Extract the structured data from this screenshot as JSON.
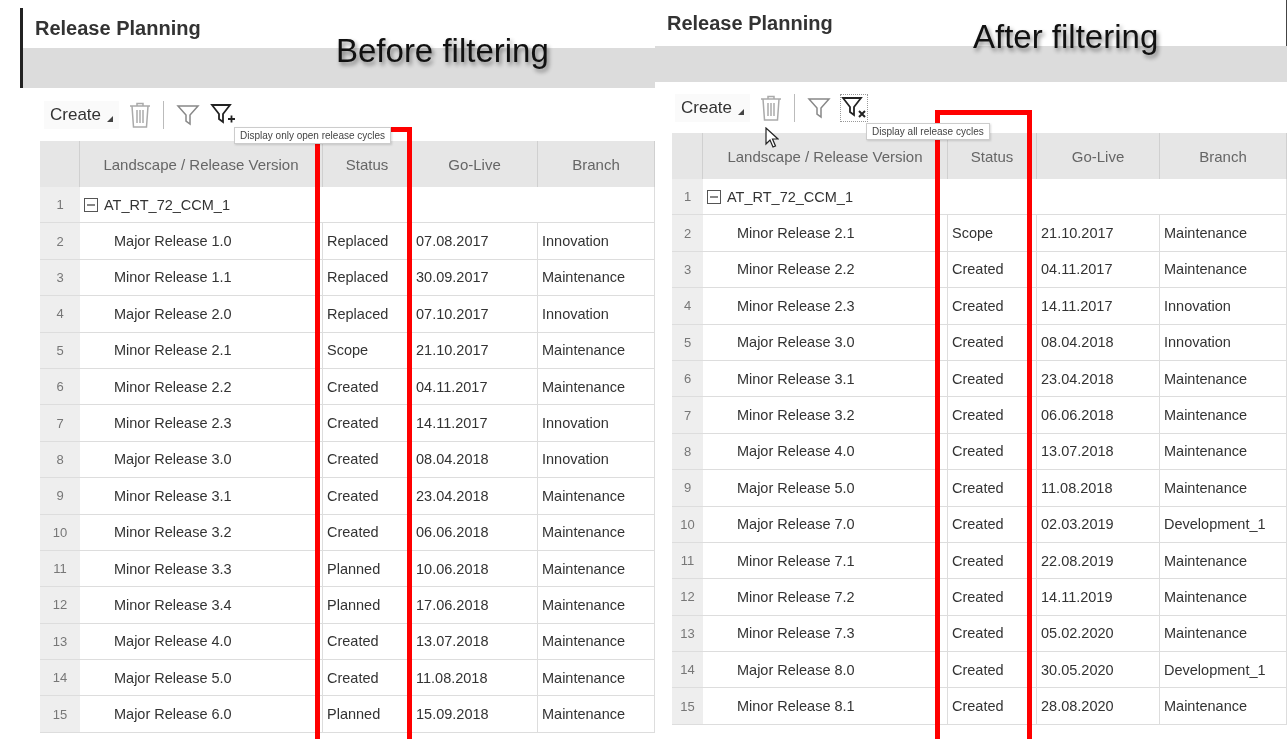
{
  "panels": [
    {
      "title": "Release Planning",
      "annotation": "Before filtering",
      "toolbar": {
        "create": "Create",
        "filter_toggle": {
          "kind": "add"
        },
        "tooltip": "Display only open release cycles",
        "pointer_cursor": false
      },
      "columns": [
        "Landscape / Release Version",
        "Status",
        "Go-Live",
        "Branch"
      ],
      "rows": [
        {
          "number": "1",
          "name": "AT_RT_72_CCM_1",
          "expanded": true,
          "children": [
            {
              "number": "2",
              "name": "Major Release 1.0",
              "status": "Replaced",
              "go_live": "07.08.2017",
              "branch": "Innovation"
            },
            {
              "number": "3",
              "name": "Minor Release 1.1",
              "status": "Replaced",
              "go_live": "30.09.2017",
              "branch": "Maintenance"
            },
            {
              "number": "4",
              "name": "Major Release 2.0",
              "status": "Replaced",
              "go_live": "07.10.2017",
              "branch": "Innovation"
            },
            {
              "number": "5",
              "name": "Minor Release 2.1",
              "status": "Scope",
              "go_live": "21.10.2017",
              "branch": "Maintenance"
            },
            {
              "number": "6",
              "name": "Minor Release 2.2",
              "status": "Created",
              "go_live": "04.11.2017",
              "branch": "Maintenance"
            },
            {
              "number": "7",
              "name": "Minor Release 2.3",
              "status": "Created",
              "go_live": "14.11.2017",
              "branch": "Innovation"
            },
            {
              "number": "8",
              "name": "Major Release 3.0",
              "status": "Created",
              "go_live": "08.04.2018",
              "branch": "Innovation"
            },
            {
              "number": "9",
              "name": "Minor Release 3.1",
              "status": "Created",
              "go_live": "23.04.2018",
              "branch": "Maintenance"
            },
            {
              "number": "10",
              "name": "Minor Release 3.2",
              "status": "Created",
              "go_live": "06.06.2018",
              "branch": "Maintenance"
            },
            {
              "number": "11",
              "name": "Minor Release 3.3",
              "status": "Planned",
              "go_live": "10.06.2018",
              "branch": "Maintenance"
            },
            {
              "number": "12",
              "name": "Minor Release 3.4",
              "status": "Planned",
              "go_live": "17.06.2018",
              "branch": "Maintenance"
            },
            {
              "number": "13",
              "name": "Major Release 4.0",
              "status": "Created",
              "go_live": "13.07.2018",
              "branch": "Maintenance"
            },
            {
              "number": "14",
              "name": "Major Release 5.0",
              "status": "Created",
              "go_live": "11.08.2018",
              "branch": "Maintenance"
            },
            {
              "number": "15",
              "name": "Major Release 6.0",
              "status": "Planned",
              "go_live": "15.09.2018",
              "branch": "Maintenance"
            }
          ]
        }
      ]
    },
    {
      "title": "Release Planning",
      "annotation": "After filtering",
      "toolbar": {
        "create": "Create",
        "filter_toggle": {
          "kind": "clear"
        },
        "tooltip": "Display all release cycles",
        "pointer_cursor": true
      },
      "columns": [
        "Landscape / Release Version",
        "Status",
        "Go-Live",
        "Branch"
      ],
      "rows": [
        {
          "number": "1",
          "name": "AT_RT_72_CCM_1",
          "expanded": true,
          "children": [
            {
              "number": "2",
              "name": "Minor Release 2.1",
              "status": "Scope",
              "go_live": "21.10.2017",
              "branch": "Maintenance"
            },
            {
              "number": "3",
              "name": "Minor Release 2.2",
              "status": "Created",
              "go_live": "04.11.2017",
              "branch": "Maintenance"
            },
            {
              "number": "4",
              "name": "Minor Release 2.3",
              "status": "Created",
              "go_live": "14.11.2017",
              "branch": "Innovation"
            },
            {
              "number": "5",
              "name": "Major Release 3.0",
              "status": "Created",
              "go_live": "08.04.2018",
              "branch": "Innovation"
            },
            {
              "number": "6",
              "name": "Minor Release 3.1",
              "status": "Created",
              "go_live": "23.04.2018",
              "branch": "Maintenance"
            },
            {
              "number": "7",
              "name": "Minor Release 3.2",
              "status": "Created",
              "go_live": "06.06.2018",
              "branch": "Maintenance"
            },
            {
              "number": "8",
              "name": "Major Release 4.0",
              "status": "Created",
              "go_live": "13.07.2018",
              "branch": "Maintenance"
            },
            {
              "number": "9",
              "name": "Major Release 5.0",
              "status": "Created",
              "go_live": "11.08.2018",
              "branch": "Maintenance"
            },
            {
              "number": "10",
              "name": "Major Release 7.0",
              "status": "Created",
              "go_live": "02.03.2019",
              "branch": "Development_1"
            },
            {
              "number": "11",
              "name": "Minor Release 7.1",
              "status": "Created",
              "go_live": "22.08.2019",
              "branch": "Maintenance"
            },
            {
              "number": "12",
              "name": "Minor Release 7.2",
              "status": "Created",
              "go_live": "14.11.2019",
              "branch": "Maintenance"
            },
            {
              "number": "13",
              "name": "Minor Release 7.3",
              "status": "Created",
              "go_live": "05.02.2020",
              "branch": "Maintenance"
            },
            {
              "number": "14",
              "name": "Major Release 8.0",
              "status": "Created",
              "go_live": "30.05.2020",
              "branch": "Development_1"
            },
            {
              "number": "15",
              "name": "Minor Release 8.1",
              "status": "Created",
              "go_live": "28.08.2020",
              "branch": "Maintenance"
            }
          ]
        }
      ]
    }
  ]
}
